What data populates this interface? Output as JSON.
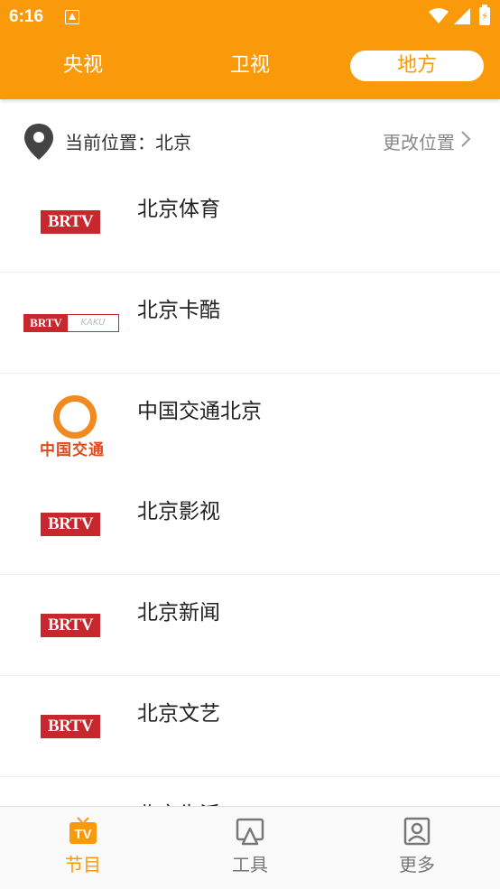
{
  "status_bar": {
    "time": "6:16"
  },
  "tabs": [
    {
      "label": "央视"
    },
    {
      "label": "卫视"
    },
    {
      "label": "地方"
    }
  ],
  "location": {
    "current_label": "当前位置：北京",
    "change_label": "更改位置"
  },
  "channels": [
    {
      "name": "北京体育",
      "logo_text": "BRTV"
    },
    {
      "name": "北京卡酷",
      "logo_text": "BRTV",
      "logo_sub": "KAKU"
    },
    {
      "name": "中国交通北京",
      "logo_text": "中国交通"
    },
    {
      "name": "北京影视",
      "logo_text": "BRTV"
    },
    {
      "name": "北京新闻",
      "logo_text": "BRTV"
    },
    {
      "name": "北京文艺",
      "logo_text": "BRTV"
    },
    {
      "name": "北京生活"
    }
  ],
  "bottom_nav": [
    {
      "label": "节目",
      "icon": "tv-icon",
      "badge": "TV"
    },
    {
      "label": "工具",
      "icon": "cast-icon"
    },
    {
      "label": "更多",
      "icon": "profile-icon"
    }
  ],
  "colors": {
    "accent": "#fa9a0a",
    "brtv_red": "#c8282d",
    "text_dark": "#222222",
    "text_muted": "#888888"
  }
}
